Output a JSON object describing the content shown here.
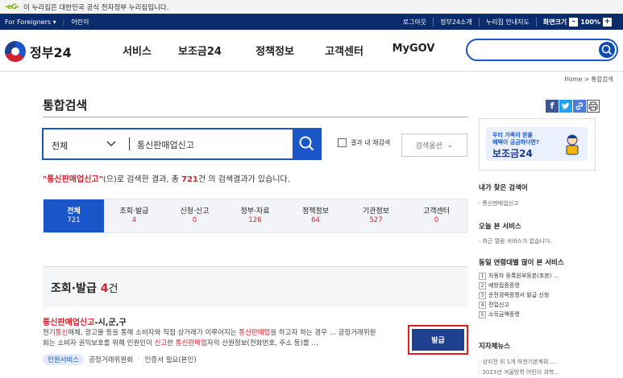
{
  "gov_banner": {
    "logo": "-eG-",
    "text": "이 누리집은 대한민국 공식 전자정부 누리집입니다."
  },
  "util_bar": {
    "for_foreigners": "For Foreigners ▾",
    "kids": "어린이",
    "logout": "로그아웃",
    "about": "정부24소개",
    "guide": "누리집 안내지도",
    "zoom_label": "화면크기",
    "zoom_minus": "–",
    "zoom_value": "100%",
    "zoom_plus": "+"
  },
  "header": {
    "brand": "정부24",
    "nav": [
      "서비스",
      "보조금24",
      "정책정보",
      "고객센터",
      "MyGOV"
    ]
  },
  "breadcrumb": "Home > 통합검색",
  "page_title": "통합검색",
  "search": {
    "category": "전체",
    "query": "통신판매업신고",
    "research_label": "결과 내 재검색",
    "options_label": "검색옵션",
    "options_chevron": "⌄"
  },
  "result": {
    "keyword": "\"통신판매업신고\"",
    "pre": "(으)로 검색한 결과, 총 ",
    "count": "721",
    "post": "건 의 검색결과가 있습니다."
  },
  "tabs": [
    {
      "label": "전체",
      "count": "721"
    },
    {
      "label": "조회·발급",
      "count": "4"
    },
    {
      "label": "신청·신고",
      "count": "0"
    },
    {
      "label": "정부·자료",
      "count": "126"
    },
    {
      "label": "정책정보",
      "count": "64"
    },
    {
      "label": "기관정보",
      "count": "527"
    },
    {
      "label": "고객센터",
      "count": "0"
    }
  ],
  "section": {
    "title": "조회·발급",
    "count": "4",
    "unit": "건"
  },
  "item": {
    "title_hl": "통신판매업신고",
    "title_rest": "-시,군,구",
    "desc_1a": "전기",
    "desc_1b": "통신",
    "desc_1c": "매체, 광고물 등을 통해 소비자와 직접 상거래가 이루어지는 ",
    "desc_1d": "통신판매업",
    "desc_1e": "을 하고자 하는 경우 ... 공정거래위원",
    "desc_2a": "회는 소비자 권익보호를 위해 민원인이 ",
    "desc_2b": "신고",
    "desc_2c": "한 ",
    "desc_2d": "통신판매업",
    "desc_2e": "자의 신원정보(전화번호, 주소 등)를 ...",
    "tag": "민원서비스",
    "agency": "공정거래위원회",
    "cert": "인증서 필요(본인)",
    "action": "발급"
  },
  "sidebar": {
    "promo_l1": "우리 가족이 받을",
    "promo_l2": "혜택이 궁금하다면?",
    "promo_title": "보조금24",
    "my_search_title": "내가 찾은 검색어",
    "my_search_item": "· 통신판매업신고",
    "today_title": "오늘 본 서비스",
    "today_item": "· 최근 열람 서비스가 없습니다.",
    "popular_title": "동일 연령대별 많이 본 서비스",
    "popular": [
      "자동차 등록원부등본(초본) ...",
      "예방접종증명",
      "운전경력증명서 발급 신청",
      "전입신고",
      "소득금액증명"
    ],
    "news_title": "지자체뉴스",
    "news": [
      "· 상지전 외 1개 하천기본계획 ...",
      "· 2023년 겨울방학 어린이 과학..."
    ]
  }
}
